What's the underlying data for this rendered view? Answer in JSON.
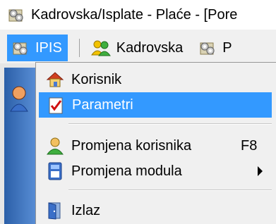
{
  "window": {
    "title": "Kadrovska/Isplate - Plaće - [Pore"
  },
  "menubar": {
    "items": [
      {
        "label": "IPIS",
        "icon": "gear-icon",
        "active": true
      },
      {
        "label": "Kadrovska",
        "icon": "users-icon",
        "active": false
      },
      {
        "label": "P",
        "icon": "gear-icon",
        "active": false
      }
    ]
  },
  "dropdown": {
    "items": [
      {
        "label": "Korisnik",
        "icon": "home-icon",
        "shortcut": "",
        "submenu": false
      },
      {
        "label": "Parametri",
        "icon": "checklist-icon",
        "shortcut": "",
        "submenu": false,
        "selected": true
      },
      {
        "label": "Promjena korisnika",
        "icon": "user-icon",
        "shortcut": "F8",
        "submenu": false
      },
      {
        "label": "Promjena modula",
        "icon": "module-icon",
        "shortcut": "",
        "submenu": true
      },
      {
        "label": "Izlaz",
        "icon": "exit-door-icon",
        "shortcut": "",
        "submenu": false
      }
    ]
  },
  "colors": {
    "highlight": "#3399ff",
    "menu_bg": "#f0f0f0"
  }
}
